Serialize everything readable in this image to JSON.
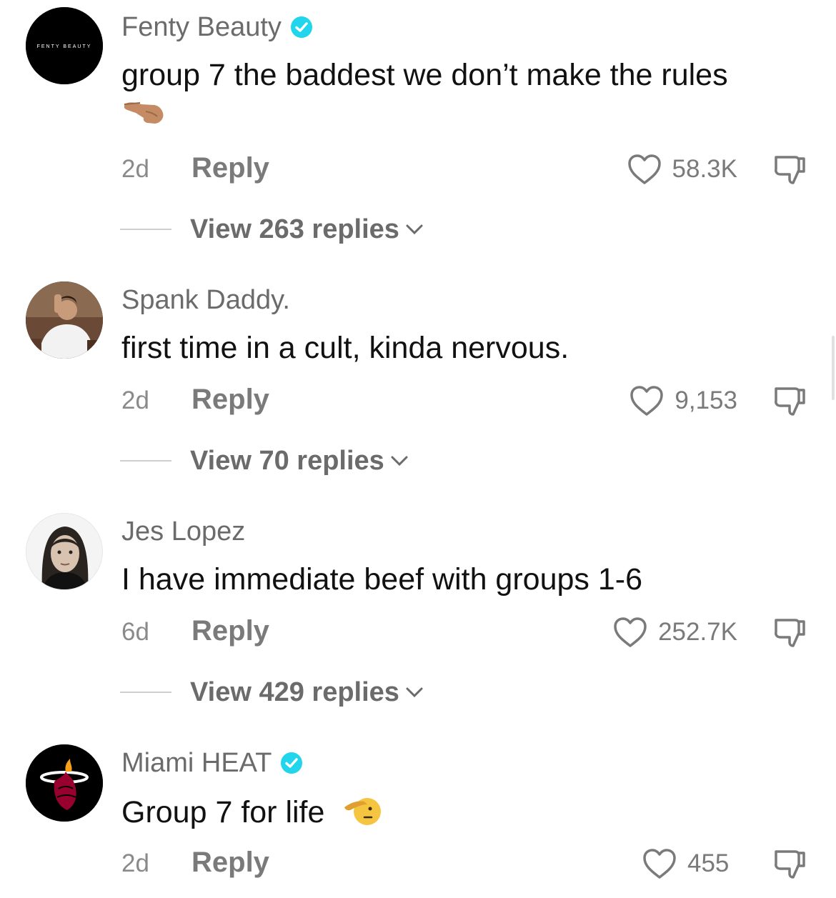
{
  "comments": [
    {
      "username": "Fenty Beauty",
      "verified": true,
      "avatar_icon": "fenty-beauty-logo",
      "avatar_text": "FENTY BEAUTY",
      "text": "group 7 the baddest we don’t make the rules",
      "emoji": "backhand-index-pointing-left-emoji",
      "time": "2d",
      "reply_label": "Reply",
      "likes": "58.3K",
      "view_replies": "View 263 replies"
    },
    {
      "username": "Spank Daddy.",
      "verified": false,
      "avatar_icon": "user-photo-avatar",
      "text": "first time in a cult, kinda nervous.",
      "time": "2d",
      "reply_label": "Reply",
      "likes": "9,153",
      "view_replies": "View 70 replies"
    },
    {
      "username": "Jes Lopez",
      "verified": false,
      "avatar_icon": "user-photo-avatar",
      "text": "I have immediate beef with groups 1-6",
      "time": "6d",
      "reply_label": "Reply",
      "likes": "252.7K",
      "view_replies": "View 429 replies"
    },
    {
      "username": "Miami HEAT",
      "verified": true,
      "avatar_icon": "miami-heat-logo",
      "text": "Group 7 for life",
      "emoji": "saluting-face-emoji",
      "time": "2d",
      "reply_label": "Reply",
      "likes": "455"
    }
  ],
  "colors": {
    "verified_badge": "#20d5ec",
    "username": "#6b6b6b",
    "body_text": "#111111",
    "meta_text": "#8a8a8a"
  }
}
